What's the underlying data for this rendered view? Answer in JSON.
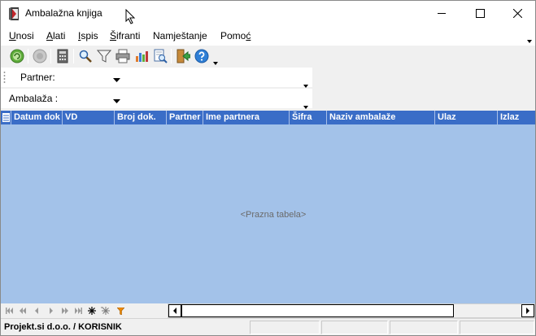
{
  "window": {
    "title": "Ambalažna knjiga",
    "icons": {
      "app": "book-icon",
      "minimize": "minimize-icon",
      "maximize": "maximize-icon",
      "close": "close-icon"
    }
  },
  "menu": {
    "items": [
      {
        "label": "Unosi",
        "underline": "U",
        "rest": "nosi"
      },
      {
        "label": "Alati",
        "underline": "A",
        "rest": "lati"
      },
      {
        "label": "Ispis",
        "underline": "I",
        "rest": "spis"
      },
      {
        "label": "Šifranti",
        "underline": "Š",
        "rest": "ifranti"
      },
      {
        "label": "Namještanje",
        "pre": "Nam",
        "underline": "j",
        "rest": "eštanje"
      },
      {
        "label": "Pomoć",
        "pre": "Pomo",
        "underline": "ć",
        "rest": ""
      }
    ]
  },
  "toolbar": {
    "buttons": [
      "refresh-icon",
      "disabled-icon",
      "calculator-icon",
      "search-icon",
      "filter-icon",
      "print-icon",
      "chart-icon",
      "preview-icon",
      "exit-icon",
      "help-icon"
    ]
  },
  "filters": {
    "partner_label": "Partner:",
    "ambalaza_label": "Ambalaža :"
  },
  "grid": {
    "columns": [
      "Datum dok",
      "VD",
      "Broj dok.",
      "Partner",
      "Ime partnera",
      "Šifra",
      "Naziv ambalaže",
      "Ulaz",
      "Izlaz"
    ],
    "empty_message": "<Prazna tabela>",
    "header_color": "#3a6dc7",
    "body_color": "#a3c2e9"
  },
  "navigator": {
    "buttons": [
      "first-icon",
      "prev-page-icon",
      "prev-icon",
      "next-icon",
      "next-page-icon",
      "last-icon",
      "insert-icon",
      "delete-icon",
      "filter-small-icon"
    ]
  },
  "status": {
    "text": "Projekt.si d.o.o. / KORISNIK"
  }
}
